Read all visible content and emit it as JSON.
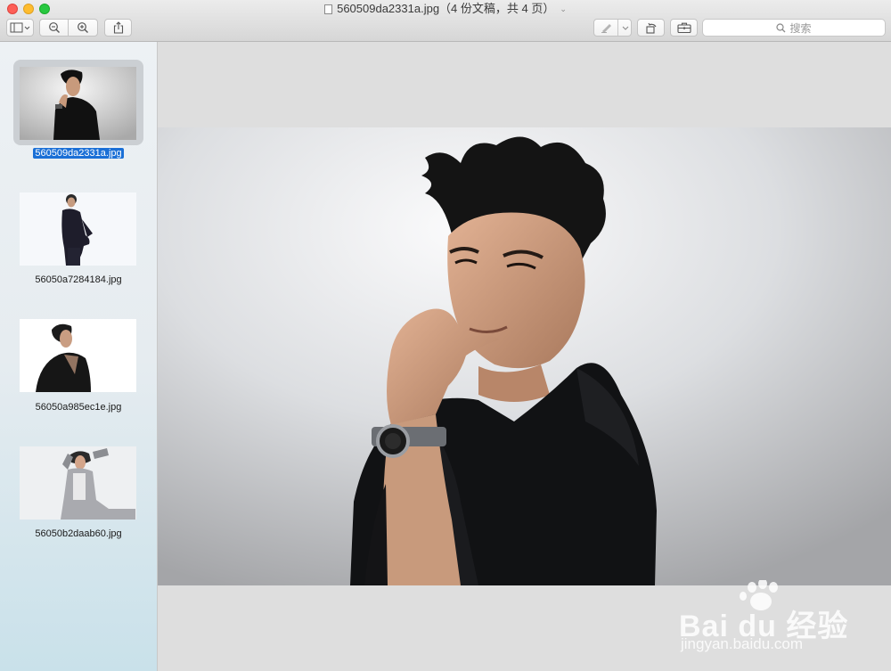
{
  "window": {
    "title": "560509da2331a.jpg（4 份文稿，共 4 页）"
  },
  "toolbar": {
    "search_placeholder": "搜索"
  },
  "sidebar": {
    "items": [
      {
        "label": "560509da2331a.jpg",
        "selected": true
      },
      {
        "label": "56050a7284184.jpg",
        "selected": false
      },
      {
        "label": "56050a985ec1e.jpg",
        "selected": false
      },
      {
        "label": "56050b2daab60.jpg",
        "selected": false
      }
    ]
  },
  "watermark": {
    "brand": "Bai du 经验",
    "url": "jingyan.baidu.com"
  },
  "icons": [
    "sidebar-toggle-icon",
    "zoom-out-icon",
    "zoom-in-icon",
    "share-icon",
    "markup-pen-icon",
    "rotate-icon",
    "toolbox-icon",
    "search-icon"
  ]
}
